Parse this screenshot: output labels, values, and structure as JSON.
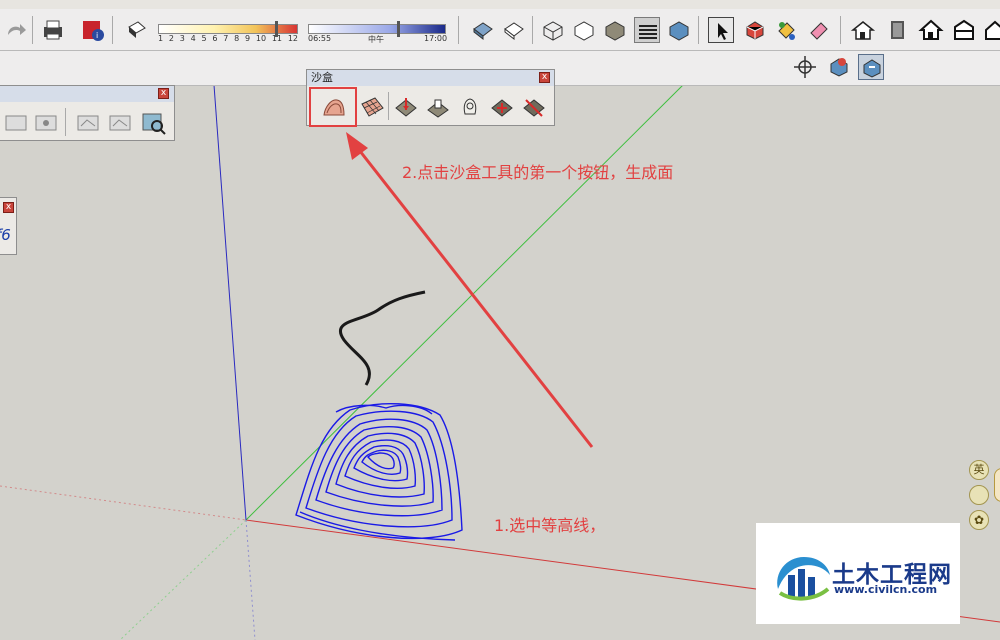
{
  "toolbar": {
    "shadow_hours": [
      "1",
      "2",
      "3",
      "4",
      "5",
      "6",
      "7",
      "8",
      "9",
      "10",
      "11",
      "12"
    ],
    "time_start": "06:55",
    "time_mid": "中午",
    "time_end": "17:00"
  },
  "sandbox_panel": {
    "title": "沙盒",
    "close_label": "x"
  },
  "left_panel": {
    "close_label": "x",
    "partial_text": "f6"
  },
  "annotations": {
    "step2": "2.点击沙盒工具的第一个按钮，生成面",
    "step1": "1.选中等高线，"
  },
  "side_icons": {
    "top_label": "英"
  },
  "watermark": {
    "name": "土木工程网",
    "url": "www.civilcn.com"
  },
  "colors": {
    "annotation": "#e24141",
    "contours": "#1a1ae6",
    "axis_red": "#d23a3a",
    "axis_green": "#3fbf3f",
    "axis_blue": "#2a2ac0"
  }
}
